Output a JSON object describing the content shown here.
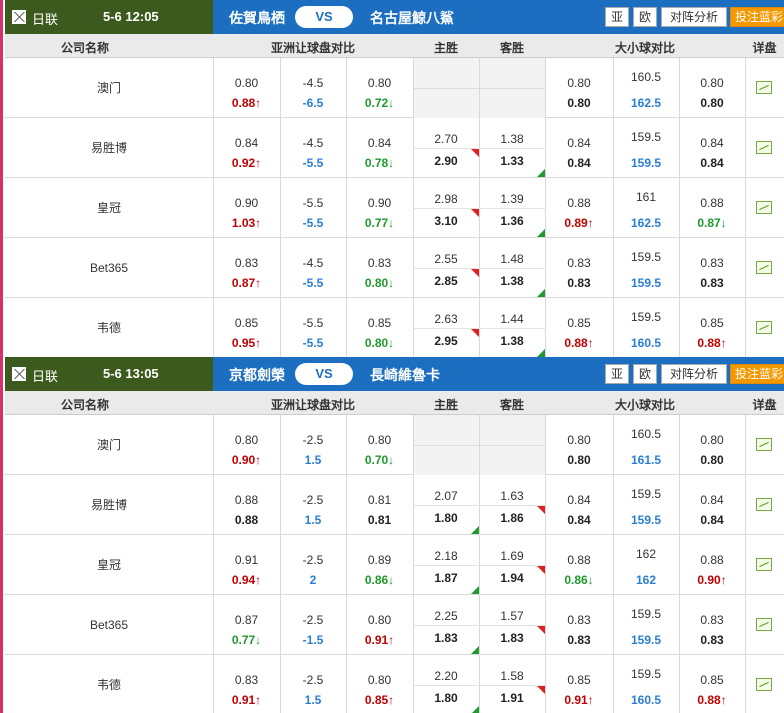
{
  "colors": {
    "league_bg": "#3d5a1e",
    "team_bar": "#1c6fc0",
    "orange_button": "#f39800",
    "up_red": "#c00000",
    "down_green": "#1e9a2c",
    "blue_value": "#2a7ed3",
    "left_accent": "#d6316b"
  },
  "columns": {
    "company": "公司名称",
    "asian": "亚洲让球盘对比",
    "home_win": "主胜",
    "away_win": "客胜",
    "ou": "大小球对比",
    "detail": "详盘"
  },
  "buttons": {
    "asia": "亚",
    "euro": "欧",
    "analysis": "对阵分析",
    "bet": "投注蓝彩"
  },
  "vs": "VS",
  "detail_icon": "chart-icon",
  "matches": [
    {
      "league": "日联",
      "datetime": "5-6 12:05",
      "home": "佐賀鳥栖",
      "away": "名古屋鯨八鯊",
      "rows": [
        {
          "company": "澳门",
          "ah": {
            "h1": "0.80",
            "l1": "-4.5",
            "a1": "0.80",
            "h2": "0.88↑",
            "l2": "-6.5",
            "a2": "0.72↓"
          },
          "wl": {
            "h1": "",
            "a1": "",
            "h2": "",
            "a2": ""
          },
          "ou": {
            "o1": "0.80",
            "l1": "160.5",
            "u1": "0.80",
            "o2": "0.80",
            "l2": "162.5",
            "u2": "0.80"
          }
        },
        {
          "company": "易胜博",
          "ah": {
            "h1": "0.84",
            "l1": "-4.5",
            "a1": "0.84",
            "h2": "0.92↑",
            "l2": "-5.5",
            "a2": "0.78↓"
          },
          "wl": {
            "h1": "2.70",
            "a1": "1.38",
            "h2": "2.90",
            "a2": "1.33"
          },
          "ou": {
            "o1": "0.84",
            "l1": "159.5",
            "u1": "0.84",
            "o2": "0.84",
            "l2": "159.5",
            "u2": "0.84"
          }
        },
        {
          "company": "皇冠",
          "ah": {
            "h1": "0.90",
            "l1": "-5.5",
            "a1": "0.90",
            "h2": "1.03↑",
            "l2": "-5.5",
            "a2": "0.77↓"
          },
          "wl": {
            "h1": "2.98",
            "a1": "1.39",
            "h2": "3.10",
            "a2": "1.36"
          },
          "ou": {
            "o1": "0.88",
            "l1": "161",
            "u1": "0.88",
            "o2": "0.89↑",
            "l2": "162.5",
            "u2": "0.87↓"
          }
        },
        {
          "company": "Bet365",
          "ah": {
            "h1": "0.83",
            "l1": "-4.5",
            "a1": "0.83",
            "h2": "0.87↑",
            "l2": "-5.5",
            "a2": "0.80↓"
          },
          "wl": {
            "h1": "2.55",
            "a1": "1.48",
            "h2": "2.85",
            "a2": "1.38"
          },
          "ou": {
            "o1": "0.83",
            "l1": "159.5",
            "u1": "0.83",
            "o2": "0.83",
            "l2": "159.5",
            "u2": "0.83"
          }
        },
        {
          "company": "韦德",
          "ah": {
            "h1": "0.85",
            "l1": "-5.5",
            "a1": "0.85",
            "h2": "0.95↑",
            "l2": "-5.5",
            "a2": "0.80↓"
          },
          "wl": {
            "h1": "2.63",
            "a1": "1.44",
            "h2": "2.95",
            "a2": "1.38"
          },
          "ou": {
            "o1": "0.85",
            "l1": "159.5",
            "u1": "0.85",
            "o2": "0.88↑",
            "l2": "160.5",
            "u2": "0.88↑"
          }
        }
      ]
    },
    {
      "league": "日联",
      "datetime": "5-6 13:05",
      "home": "京都劍榮",
      "away": "長崎維魯卡",
      "rows": [
        {
          "company": "澳门",
          "ah": {
            "h1": "0.80",
            "l1": "-2.5",
            "a1": "0.80",
            "h2": "0.90↑",
            "l2": "1.5",
            "a2": "0.70↓"
          },
          "wl": {
            "h1": "",
            "a1": "",
            "h2": "",
            "a2": ""
          },
          "ou": {
            "o1": "0.80",
            "l1": "160.5",
            "u1": "0.80",
            "o2": "0.80",
            "l2": "161.5",
            "u2": "0.80"
          }
        },
        {
          "company": "易胜博",
          "ah": {
            "h1": "0.88",
            "l1": "-2.5",
            "a1": "0.81",
            "h2": "0.88",
            "l2": "1.5",
            "a2": "0.81"
          },
          "wl": {
            "h1": "2.07",
            "a1": "1.63",
            "h2": "1.80",
            "a2": "1.86"
          },
          "ou": {
            "o1": "0.84",
            "l1": "159.5",
            "u1": "0.84",
            "o2": "0.84",
            "l2": "159.5",
            "u2": "0.84"
          }
        },
        {
          "company": "皇冠",
          "ah": {
            "h1": "0.91",
            "l1": "-2.5",
            "a1": "0.89",
            "h2": "0.94↑",
            "l2": "2",
            "a2": "0.86↓"
          },
          "wl": {
            "h1": "2.18",
            "a1": "1.69",
            "h2": "1.87",
            "a2": "1.94"
          },
          "ou": {
            "o1": "0.88",
            "l1": "162",
            "u1": "0.88",
            "o2": "0.86↓",
            "l2": "162",
            "u2": "0.90↑"
          }
        },
        {
          "company": "Bet365",
          "ah": {
            "h1": "0.87",
            "l1": "-2.5",
            "a1": "0.80",
            "h2": "0.77↓",
            "l2": "-1.5",
            "a2": "0.91↑"
          },
          "wl": {
            "h1": "2.25",
            "a1": "1.57",
            "h2": "1.83",
            "a2": "1.83"
          },
          "ou": {
            "o1": "0.83",
            "l1": "159.5",
            "u1": "0.83",
            "o2": "0.83",
            "l2": "159.5",
            "u2": "0.83"
          }
        },
        {
          "company": "韦德",
          "ah": {
            "h1": "0.83",
            "l1": "-2.5",
            "a1": "0.80",
            "h2": "0.91↑",
            "l2": "1.5",
            "a2": "0.85↑"
          },
          "wl": {
            "h1": "2.20",
            "a1": "1.58",
            "h2": "1.80",
            "a2": "1.91"
          },
          "ou": {
            "o1": "0.85",
            "l1": "159.5",
            "u1": "0.85",
            "o2": "0.91↑",
            "l2": "160.5",
            "u2": "0.88↑"
          }
        }
      ]
    }
  ]
}
